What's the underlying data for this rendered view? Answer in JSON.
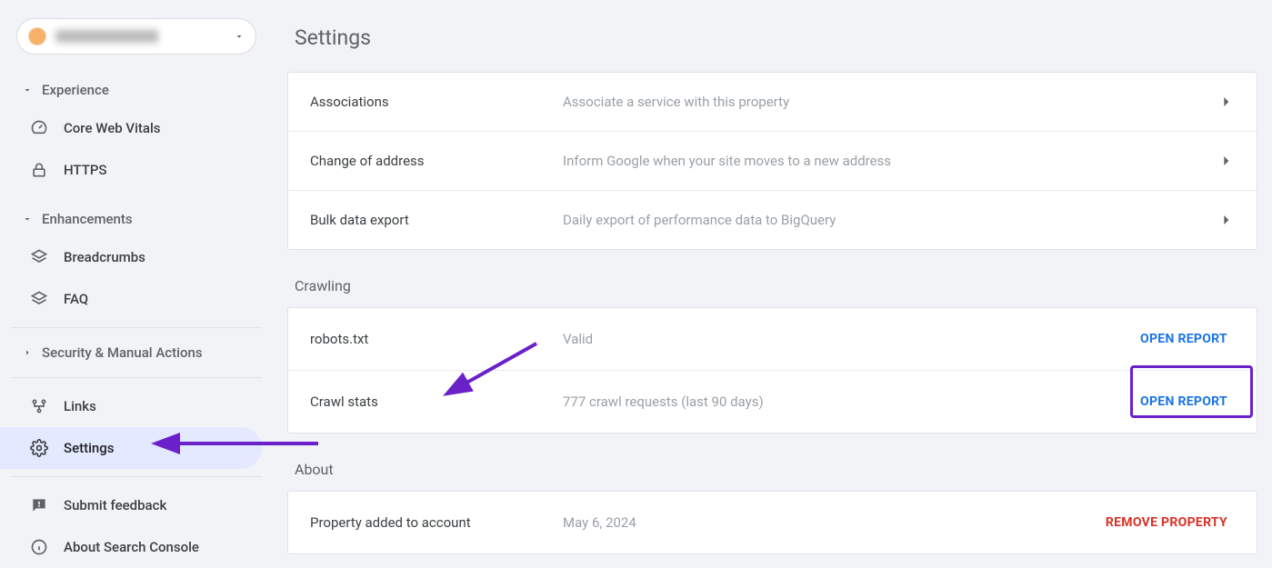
{
  "sidebar": {
    "sections": {
      "experience": {
        "label": "Experience",
        "items": [
          {
            "id": "cwv",
            "label": "Core Web Vitals",
            "icon": "speedometer-icon"
          },
          {
            "id": "https",
            "label": "HTTPS",
            "icon": "lock-icon"
          }
        ]
      },
      "enhancements": {
        "label": "Enhancements",
        "items": [
          {
            "id": "breadcrumbs",
            "label": "Breadcrumbs",
            "icon": "layers-icon"
          },
          {
            "id": "faq",
            "label": "FAQ",
            "icon": "layers-icon"
          }
        ]
      },
      "security": {
        "label": "Security & Manual Actions"
      }
    },
    "bottom": [
      {
        "id": "links",
        "label": "Links",
        "icon": "links-icon"
      },
      {
        "id": "settings",
        "label": "Settings",
        "icon": "gear-icon",
        "selected": true
      },
      {
        "id": "submit-feedback",
        "label": "Submit feedback",
        "icon": "feedback-icon"
      },
      {
        "id": "about",
        "label": "About Search Console",
        "icon": "info-icon"
      }
    ]
  },
  "main": {
    "title": "Settings",
    "general": [
      {
        "id": "associations",
        "title": "Associations",
        "desc": "Associate a service with this property"
      },
      {
        "id": "change-address",
        "title": "Change of address",
        "desc": "Inform Google when your site moves to a new address"
      },
      {
        "id": "bulk-export",
        "title": "Bulk data export",
        "desc": "Daily export of performance data to BigQuery"
      }
    ],
    "crawling": {
      "label": "Crawling",
      "rows": [
        {
          "id": "robots",
          "title": "robots.txt",
          "desc": "Valid",
          "action": "OPEN REPORT"
        },
        {
          "id": "crawl-stats",
          "title": "Crawl stats",
          "desc": "777 crawl requests (last 90 days)",
          "action": "OPEN REPORT"
        }
      ]
    },
    "about": {
      "label": "About",
      "rows": [
        {
          "id": "added",
          "title": "Property added to account",
          "desc": "May 6, 2024",
          "action": "REMOVE PROPERTY",
          "danger": true
        }
      ]
    }
  }
}
